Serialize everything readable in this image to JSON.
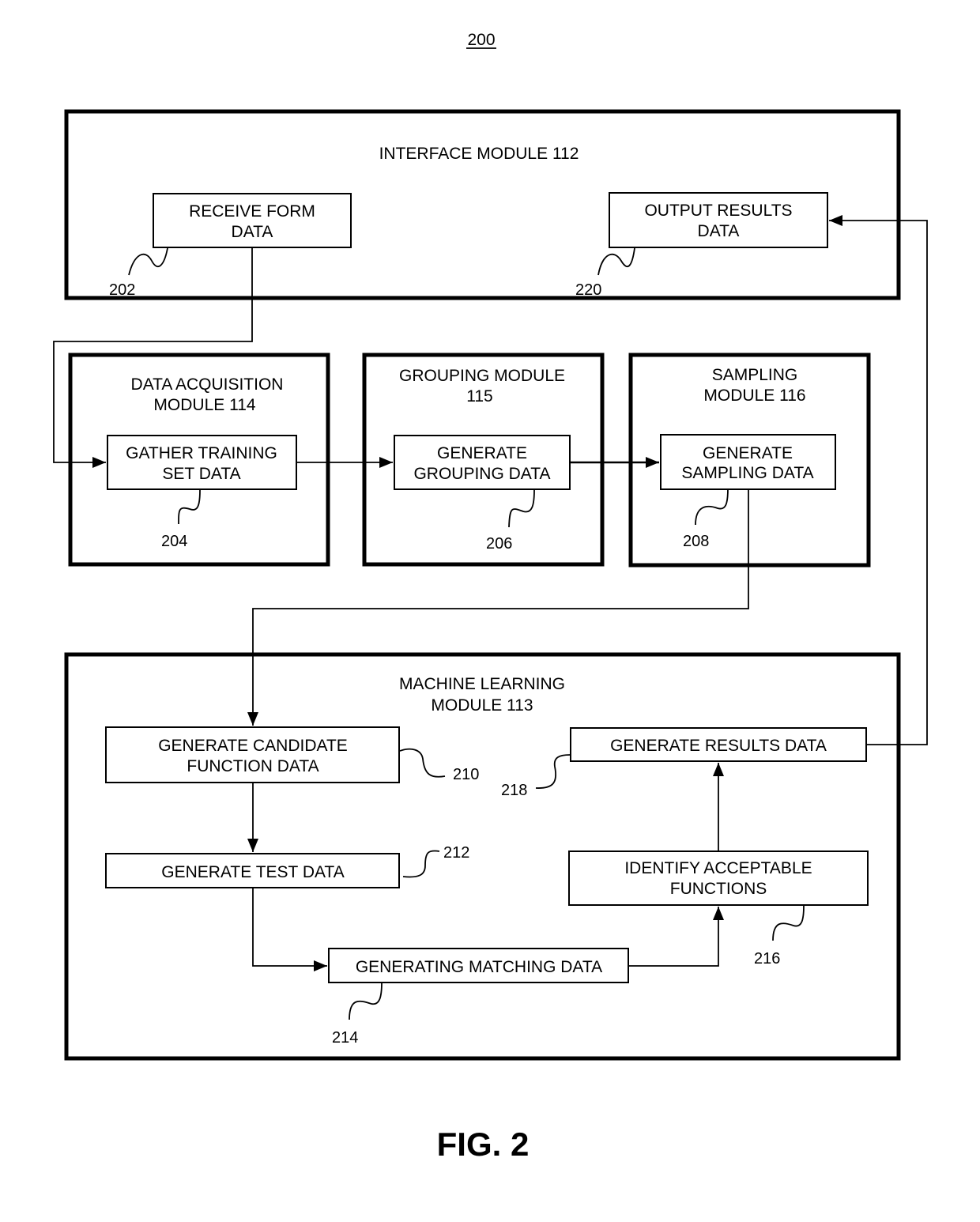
{
  "figure_number_top": "200",
  "caption": "FIG. 2",
  "modules": {
    "interface": {
      "title": [
        "INTERFACE MODULE 112"
      ]
    },
    "data_acquisition": {
      "title": [
        "DATA ACQUISITION",
        "MODULE 114"
      ]
    },
    "grouping": {
      "title": [
        "GROUPING MODULE",
        "115"
      ]
    },
    "sampling": {
      "title": [
        "SAMPLING",
        "MODULE 116"
      ]
    },
    "machine_learning": {
      "title": [
        "MACHINE LEARNING",
        "MODULE 113"
      ]
    }
  },
  "steps": {
    "s202": {
      "lines": [
        "RECEIVE FORM",
        "DATA"
      ],
      "ref": "202"
    },
    "s220": {
      "lines": [
        "OUTPUT RESULTS",
        "DATA"
      ],
      "ref": "220"
    },
    "s204": {
      "lines": [
        "GATHER TRAINING",
        "SET DATA"
      ],
      "ref": "204"
    },
    "s206": {
      "lines": [
        "GENERATE",
        "GROUPING DATA"
      ],
      "ref": "206"
    },
    "s208": {
      "lines": [
        "GENERATE",
        "SAMPLING DATA"
      ],
      "ref": "208"
    },
    "s210": {
      "lines": [
        "GENERATE CANDIDATE",
        "FUNCTION DATA"
      ],
      "ref": "210"
    },
    "s212": {
      "lines": [
        "GENERATE TEST DATA"
      ],
      "ref": "212"
    },
    "s214": {
      "lines": [
        "GENERATING MATCHING DATA"
      ],
      "ref": "214"
    },
    "s216": {
      "lines": [
        "IDENTIFY ACCEPTABLE",
        "FUNCTIONS"
      ],
      "ref": "216"
    },
    "s218": {
      "lines": [
        "GENERATE RESULTS DATA"
      ],
      "ref": "218"
    }
  },
  "flows": [
    {
      "from": "202",
      "to": "204"
    },
    {
      "from": "204",
      "to": "206"
    },
    {
      "from": "206",
      "to": "208"
    },
    {
      "from": "208",
      "to": "210"
    },
    {
      "from": "210",
      "to": "212"
    },
    {
      "from": "212",
      "to": "214"
    },
    {
      "from": "214",
      "to": "216"
    },
    {
      "from": "216",
      "to": "218"
    },
    {
      "from": "218",
      "to": "220"
    }
  ]
}
